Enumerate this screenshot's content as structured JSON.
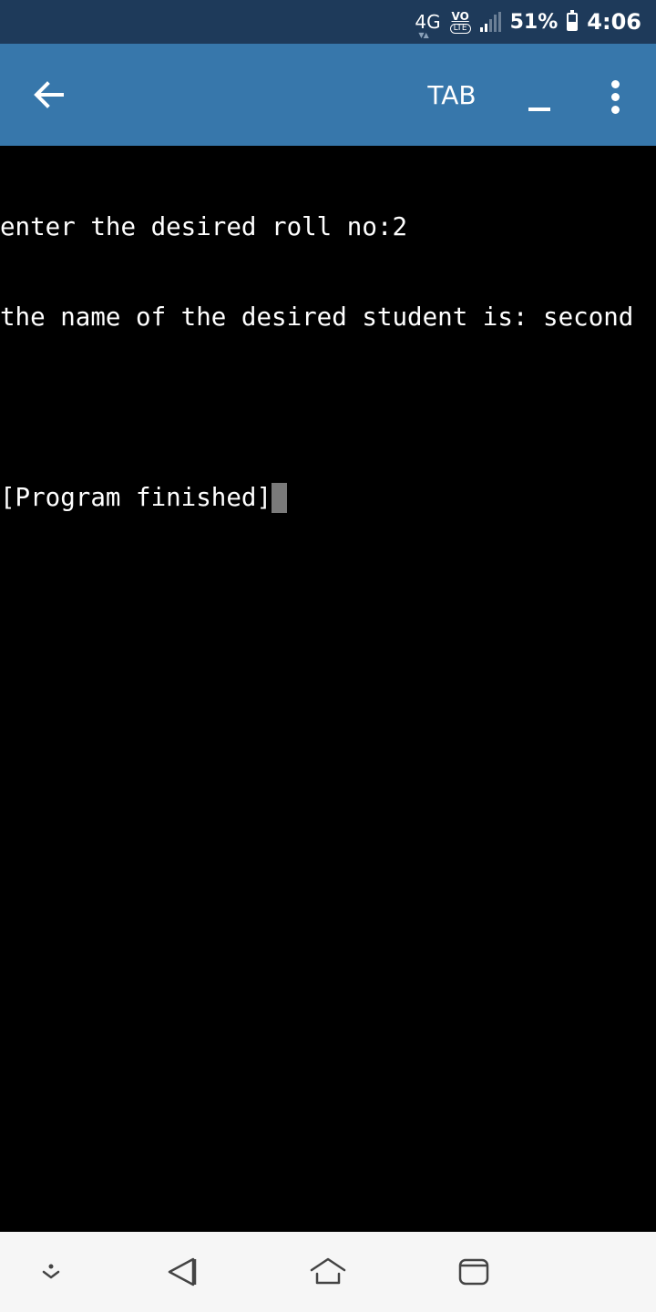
{
  "status_bar": {
    "network": "4G",
    "volte_top": "VO",
    "volte_bottom": "LTE",
    "battery_percent": "51%",
    "battery_level": 0.51,
    "time": "4:06"
  },
  "app_bar": {
    "back_icon": "arrow-left-icon",
    "tab_label": "TAB",
    "underscore_icon": "underscore-icon",
    "more_icon": "more-vert-icon"
  },
  "terminal": {
    "lines": [
      "enter the desired roll no:2",
      "the name of the desired student is: second",
      "",
      "[Program finished]"
    ]
  },
  "nav_bar": {
    "icons": [
      "keyboard-hide-icon",
      "back-triangle-icon",
      "home-icon",
      "recents-icon"
    ]
  },
  "colors": {
    "status_bar": "#1e3a5a",
    "app_bar": "#3777ab",
    "terminal_bg": "#000000",
    "terminal_fg": "#ffffff",
    "cursor": "#7a7a7a",
    "nav_bar": "#f6f6f6"
  }
}
